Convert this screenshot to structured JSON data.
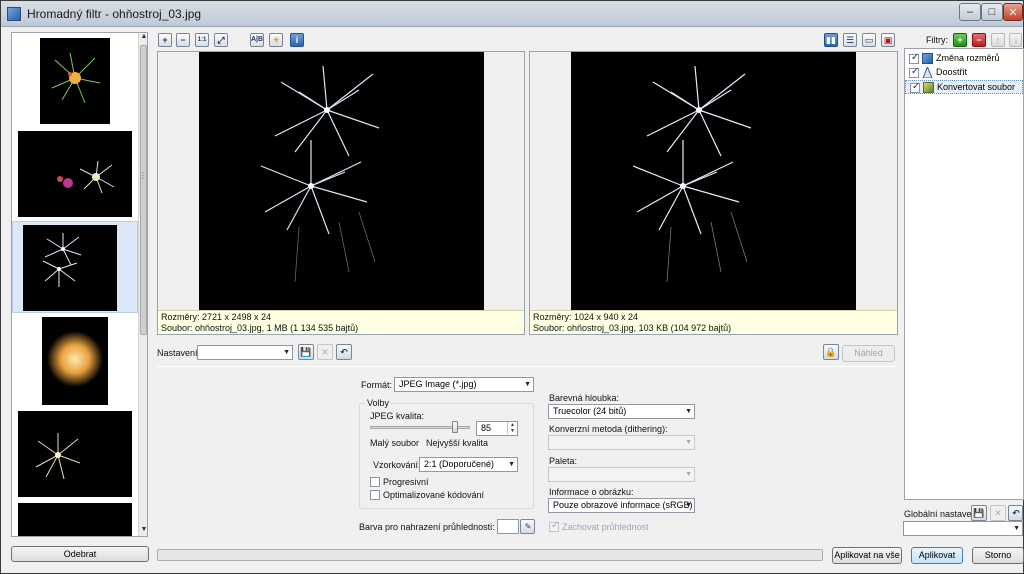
{
  "window": {
    "title": "Hromadný filtr - ohňostroj_03.jpg"
  },
  "preview": {
    "original": {
      "dimensions": "Rozměry: 2721 x 2498 x 24",
      "file": "Soubor: ohňostroj_03.jpg, 1 MB (1 134 535 bajtů)"
    },
    "result": {
      "dimensions": "Rozměry: 1024 x 940 x 24",
      "file": "Soubor: ohňostroj_03.jpg, 103 KB (104 972 bajtů)"
    }
  },
  "settings": {
    "label": "Nastavení:",
    "preview_button": "Náhled"
  },
  "format": {
    "label": "Formát:",
    "value": "JPEG Image (*.jpg)",
    "options_group": "Volby",
    "quality_label": "JPEG kvalita:",
    "quality_value": "85",
    "quality_fraction": 0.85,
    "small_file": "Malý soubor",
    "best_quality": "Nejvyšší kvalita",
    "sampling_label": "Vzorkování:",
    "sampling_value": "2:1 (Doporučené)",
    "progressive": "Progresivní",
    "optimized": "Optimalizované kódování",
    "transparency_label": "Barva pro nahrazení průhlednosti:"
  },
  "color": {
    "depth_label": "Barevná hloubka:",
    "depth_value": "Truecolor (24 bitů)",
    "dither_label": "Konverzní metoda (dithering):",
    "palette_label": "Paleta:",
    "info_label": "Informace o obrázku:",
    "info_value": "Pouze obrazové informace (sRGB)",
    "keep_transparency": "Zachovat průhlednost"
  },
  "filters": {
    "label": "Filtry:",
    "items": [
      {
        "label": "Změna rozměrů",
        "checked": true
      },
      {
        "label": "Doostřit",
        "checked": true
      },
      {
        "label": "Konvertovat soubor",
        "checked": true
      }
    ],
    "global_label": "Globální nastavení:"
  },
  "progress": {
    "fraction": 0
  },
  "buttons": {
    "remove": "Odebrat",
    "apply_all": "Aplikovat na vše",
    "apply": "Aplikovat",
    "cancel": "Storno"
  },
  "icons": {
    "zoom_in": "zoom-in-icon",
    "zoom_out": "zoom-out-icon",
    "actual_size": "actual-size-icon",
    "fit": "fit-to-window-icon",
    "add_filter": "plus-icon",
    "remove_filter": "minus-icon",
    "save": "save-icon",
    "delete": "delete-icon",
    "reset": "undo-icon"
  },
  "colors": {
    "accent": "#3c7fb1",
    "info_bg": "#ffffe4",
    "add_green": "#2b8c1f",
    "remove_red": "#b31e1e"
  }
}
